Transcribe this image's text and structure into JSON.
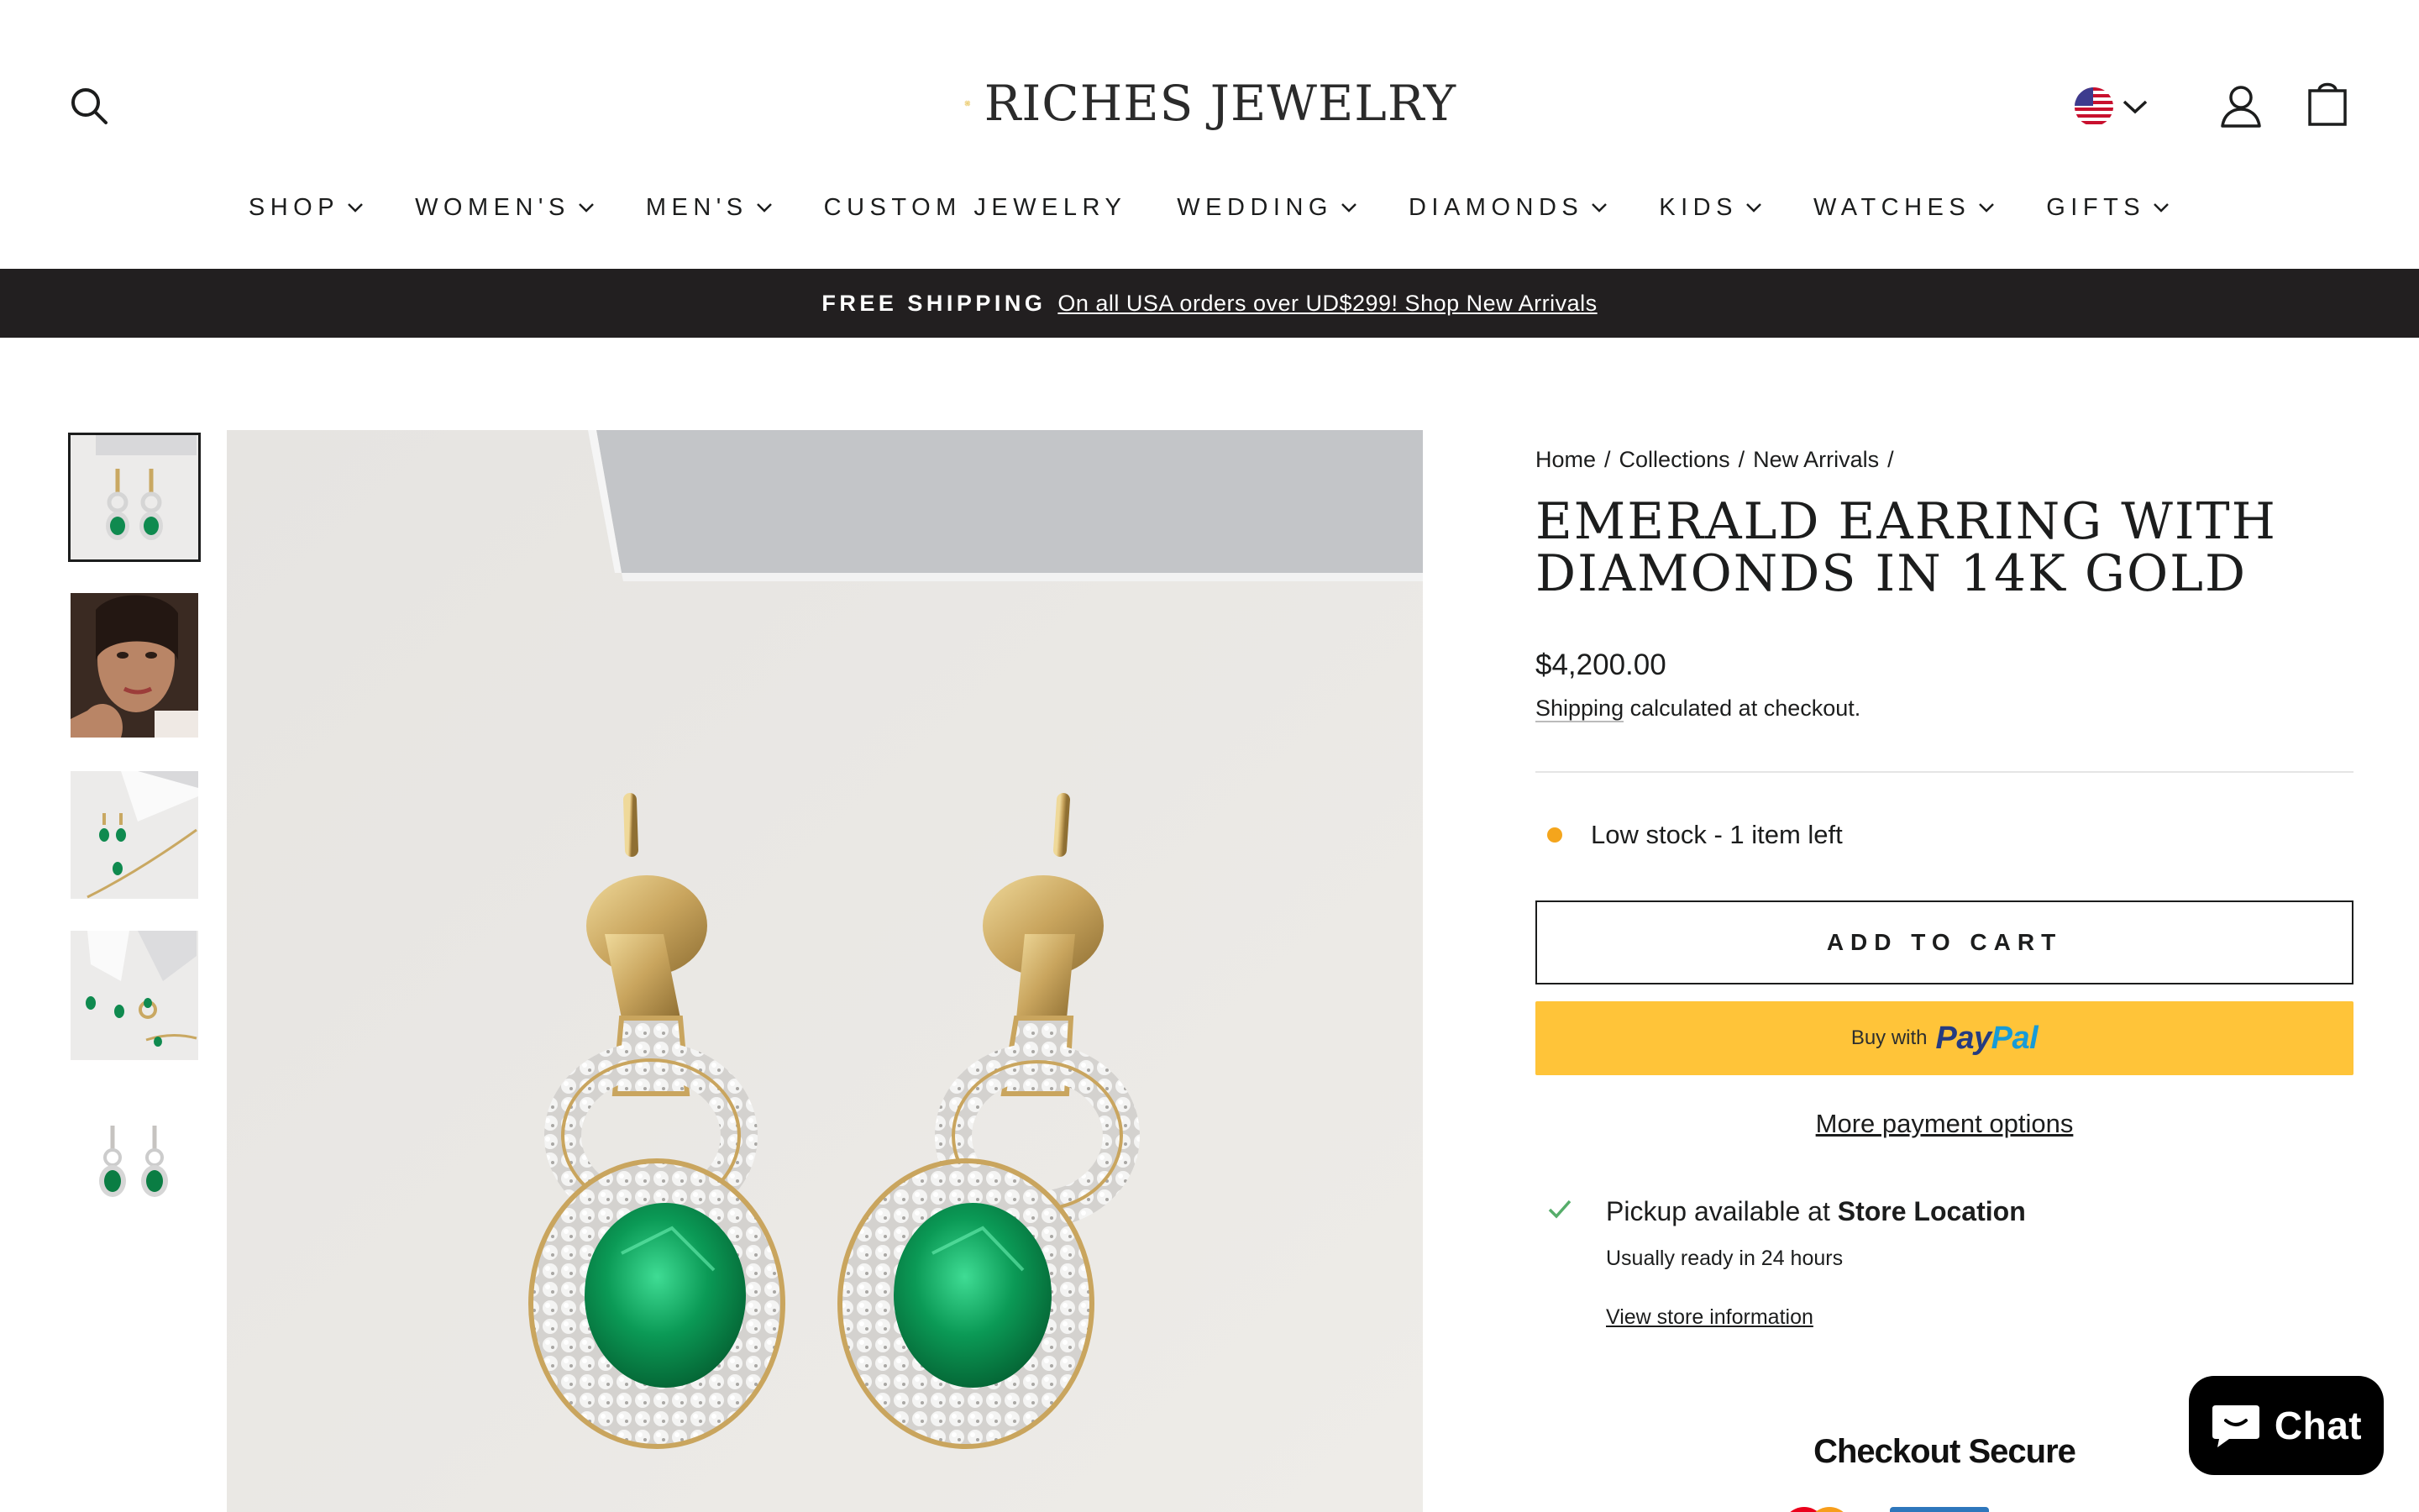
{
  "header": {
    "logo_text": "RICHES JEWELRY",
    "brand_color": "#e2b632",
    "icons": {
      "search": "search-icon",
      "country": "us-flag-icon",
      "account": "user-icon",
      "cart": "bag-icon"
    }
  },
  "nav": {
    "items": [
      {
        "label": "SHOP",
        "dropdown": true
      },
      {
        "label": "WOMEN'S",
        "dropdown": true
      },
      {
        "label": "MEN'S",
        "dropdown": true
      },
      {
        "label": "CUSTOM JEWELRY",
        "dropdown": false
      },
      {
        "label": "WEDDING",
        "dropdown": true
      },
      {
        "label": "DIAMONDS",
        "dropdown": true
      },
      {
        "label": "KIDS",
        "dropdown": true
      },
      {
        "label": "WATCHES",
        "dropdown": true
      },
      {
        "label": "GIFTS",
        "dropdown": true
      }
    ]
  },
  "announcement": {
    "strong": "FREE SHIPPING",
    "link": "On all USA orders over UD$299! Shop New Arrivals",
    "background": "#221f20"
  },
  "product": {
    "breadcrumb": [
      "Home",
      "Collections",
      "New Arrivals"
    ],
    "title": "EMERALD EARRING WITH DIAMONDS IN 14K GOLD",
    "price": "$4,200.00",
    "shipping_link": "Shipping",
    "shipping_suffix": " calculated at checkout.",
    "stock_text": "Low stock - 1 item left",
    "stock_color": "#f4a51c",
    "add_to_cart": "ADD TO CART",
    "paypal_prefix": "Buy with",
    "paypal_logo_1": "Pay",
    "paypal_logo_2": "Pal",
    "paypal_color": "#ffc439",
    "more_payment": "More payment options",
    "pickup_prefix": "Pickup available at ",
    "pickup_location": "Store Location",
    "pickup_ready": "Usually ready in 24 hours",
    "store_link": "View store information",
    "checkout_secure": "Checkout Secure"
  },
  "chat": {
    "label": "Chat"
  }
}
